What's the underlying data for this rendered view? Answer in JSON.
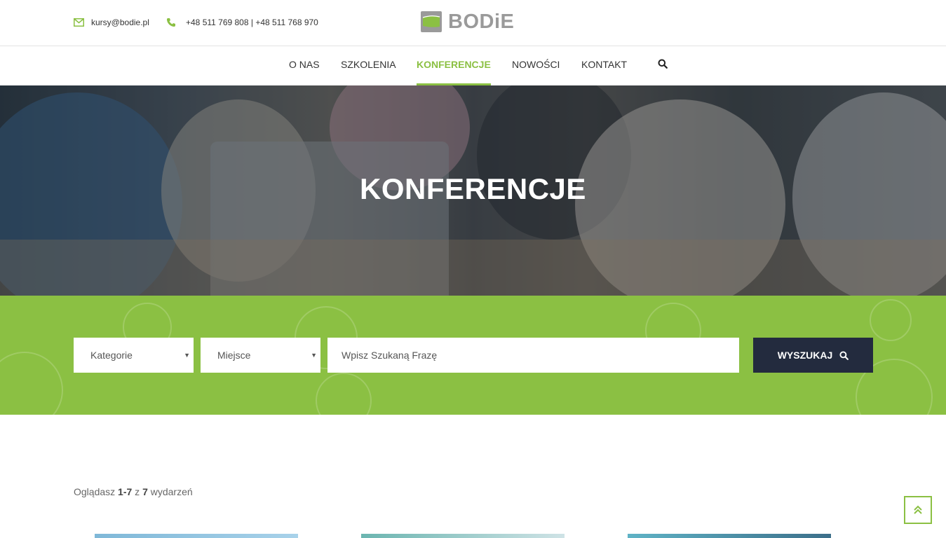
{
  "header": {
    "email": "kursy@bodie.pl",
    "phone": "+48 511 769 808 | +48 511 768 970",
    "logo_text": "BODiE"
  },
  "nav": {
    "items": [
      "O NAS",
      "SZKOLENIA",
      "KONFERENCJE",
      "NOWOŚCI",
      "KONTAKT"
    ],
    "active": "KONFERENCJE"
  },
  "hero": {
    "title": "KONFERENCJE"
  },
  "search": {
    "category_value": "Kategorie",
    "place_value": "Miejsce",
    "phrase_placeholder": "Wpisz Szukaną Frazę",
    "button_label": "WYSZUKAJ"
  },
  "results": {
    "prefix": "Oglądasz",
    "range": "1-7",
    "of": "z",
    "total": "7",
    "suffix": "wydarzeń"
  },
  "colors": {
    "accent": "#8bc043",
    "dark_button": "#232b3e"
  },
  "icons": [
    "envelope-icon",
    "phone-icon",
    "search-icon",
    "double-chevron-up-icon"
  ]
}
